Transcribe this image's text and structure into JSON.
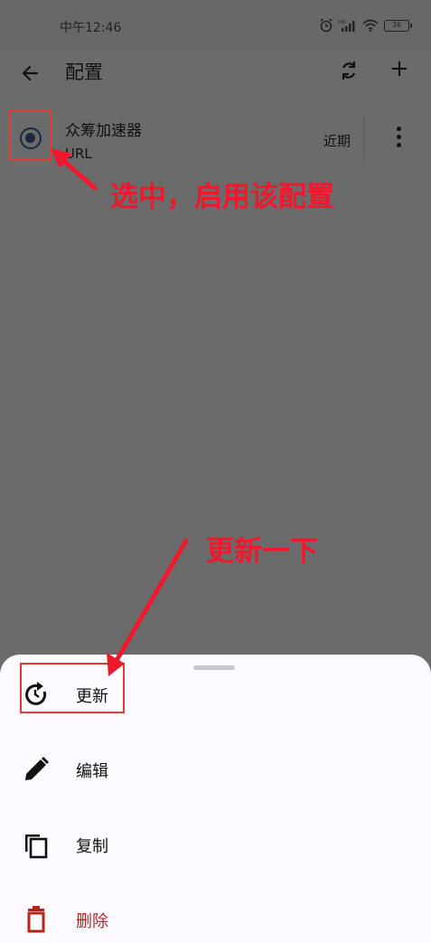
{
  "status_bar": {
    "time": "中午12:46",
    "battery": "36"
  },
  "app_bar": {
    "title": "配置"
  },
  "profile": {
    "name": "众筹加速器",
    "type": "URL",
    "updated": "近期",
    "selected": true
  },
  "annotations": {
    "select_note": "选中，启用该配置",
    "update_note": "更新一下"
  },
  "menu": {
    "items": [
      {
        "label": "更新",
        "icon": "refresh-icon"
      },
      {
        "label": "编辑",
        "icon": "pencil-icon"
      },
      {
        "label": "复制",
        "icon": "copy-icon"
      },
      {
        "label": "删除",
        "icon": "trash-icon"
      }
    ]
  },
  "colors": {
    "annotation_red": "#f0182c",
    "danger": "#b3261e",
    "scrim": "#6b6b6b",
    "sheet_bg": "#fdfbff"
  }
}
